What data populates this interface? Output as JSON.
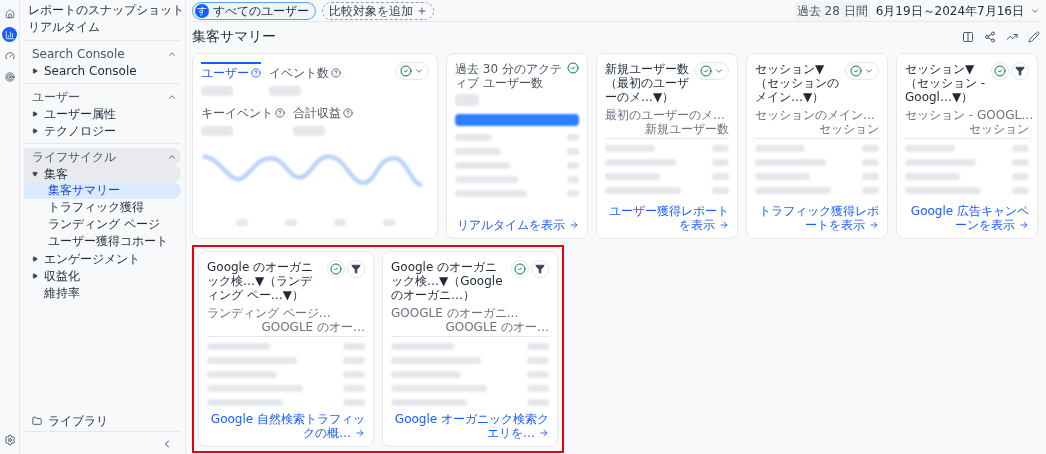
{
  "nav_rail": [
    {
      "kind": "home",
      "selected": false
    },
    {
      "kind": "reports",
      "selected": true
    },
    {
      "kind": "explore",
      "selected": false
    },
    {
      "kind": "advertising",
      "selected": false
    }
  ],
  "sidebar": {
    "items": [
      {
        "label": "レポートのスナップショット",
        "selected": false
      },
      {
        "label": "リアルタイム",
        "selected": false
      }
    ],
    "sections": [
      {
        "title": "Search Console",
        "expanded": true,
        "highlighted": false,
        "items": [
          {
            "kind": "folder",
            "label": "Search Console",
            "expanded": false
          }
        ]
      },
      {
        "title": "ユーザー",
        "expanded": true,
        "highlighted": false,
        "items": [
          {
            "kind": "folder",
            "label": "ユーザー属性",
            "expanded": false
          },
          {
            "kind": "folder",
            "label": "テクノロジー",
            "expanded": false
          }
        ]
      },
      {
        "title": "ライフサイクル",
        "expanded": true,
        "highlighted": true,
        "items": [
          {
            "kind": "folder",
            "label": "集客",
            "expanded": true,
            "children": [
              {
                "label": "集客サマリー",
                "selected": true
              },
              {
                "label": "トラフィック獲得",
                "selected": false
              },
              {
                "label": "ランディング ページ",
                "selected": false
              },
              {
                "label": "ユーザー獲得コホート",
                "selected": false
              }
            ]
          },
          {
            "kind": "folder",
            "label": "エンゲージメント",
            "expanded": false
          },
          {
            "kind": "folder",
            "label": "収益化",
            "expanded": false
          },
          {
            "kind": "page",
            "label": "維持率"
          }
        ]
      }
    ],
    "library": "ライブラリ"
  },
  "top_bar": {
    "segment": {
      "initial": "す",
      "label": "すべてのユーザー"
    },
    "add_comparison": "比較対象を追加",
    "date_range": {
      "preset": "過去 28 日間",
      "range": "6月19日～2024年7月16日"
    }
  },
  "page_title": "集客サマリー",
  "overview_card": {
    "tabs": [
      {
        "label": "ユーザー",
        "selected": true
      },
      {
        "label": "イベント数",
        "selected": false
      },
      {
        "label": "キーイベント",
        "selected": false
      },
      {
        "label": "合計収益",
        "selected": false
      }
    ]
  },
  "realtime_card": {
    "title": "過去 30 分のアクティブ ユーザー数",
    "link": "リアルタイムを表示"
  },
  "table_cards": [
    {
      "kind": "dropdown",
      "title": "新規ユーザー数（最初のユーザーのメ…▼）",
      "columns": [
        "最初のユーザーのメ…",
        "新規ユーザー数"
      ],
      "link": "ユーザー獲得レポートを表示"
    },
    {
      "kind": "dropdown",
      "title": "セッション▼（セッションのメイン…▼）",
      "columns": [
        "セッションのメイン…",
        "セッション"
      ],
      "link": "トラフィック獲得レポートを表示"
    },
    {
      "kind": "filter",
      "title": "セッション▼（セッション - Googl…▼）",
      "columns": [
        "セッション - GOOGL…",
        "セッション"
      ],
      "link": "Google 広告キャンペーンを表示"
    }
  ],
  "highlighted_row": {
    "highlighted": true,
    "cards": [
      {
        "kind": "filter",
        "title": "Google のオーガニック検…▼（ランディング ペー…▼）",
        "columns": [
          "ランディング ページ…",
          "GOOGLE のオー…"
        ],
        "link": "Google 自然検索トラフィックの概…"
      },
      {
        "kind": "filter",
        "title": "Google のオーガニック検…▼（Google のオーガニ…）",
        "columns": [
          "GOOGLE のオーガニ…",
          "GOOGLE のオー…"
        ],
        "link": "Google オーガニック検索クエリを…"
      }
    ]
  }
}
